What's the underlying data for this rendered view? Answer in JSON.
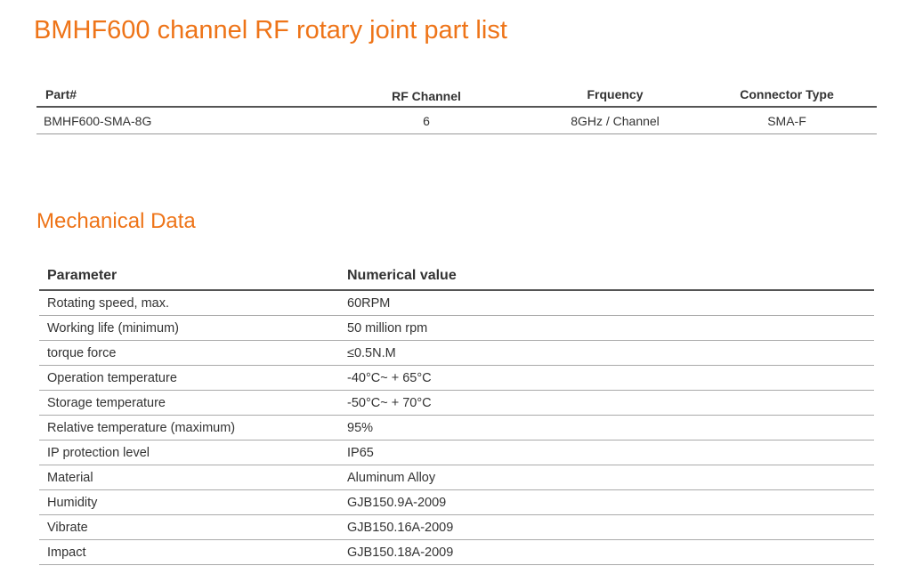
{
  "title": "BMHF600 channel RF rotary joint part list",
  "colors": {
    "accent": "#ee7418"
  },
  "parts_table": {
    "headers": [
      "Part#",
      "RF Channel",
      "Frquency",
      "Connector Type"
    ],
    "rows": [
      [
        "BMHF600-SMA-8G",
        "6",
        "8GHz / Channel",
        "SMA-F"
      ]
    ]
  },
  "mechanical": {
    "title": "Mechanical Data",
    "headers": [
      "Parameter",
      "Numerical value"
    ],
    "rows": [
      [
        "Rotating speed, max.",
        "60RPM"
      ],
      [
        "Working life (minimum)",
        "50 million rpm"
      ],
      [
        "torque force",
        "≤0.5N.M"
      ],
      [
        "Operation temperature",
        "-40°C~ + 65°C"
      ],
      [
        "Storage temperature",
        "-50°C~ + 70°C"
      ],
      [
        "Relative temperature (maximum)",
        "95%"
      ],
      [
        "IP protection level",
        "IP65"
      ],
      [
        "Material",
        "Aluminum Alloy"
      ],
      [
        "Humidity",
        "GJB150.9A-2009"
      ],
      [
        "Vibrate",
        "GJB150.16A-2009"
      ],
      [
        "Impact",
        "GJB150.18A-2009"
      ]
    ]
  }
}
